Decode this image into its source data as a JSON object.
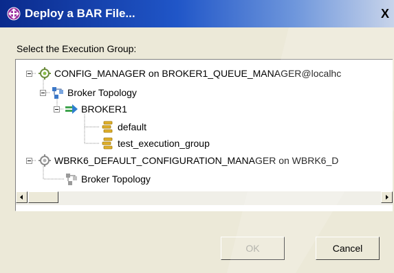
{
  "window": {
    "title": "Deploy a BAR File...",
    "close_label": "X"
  },
  "prompt": "Select the Execution Group:",
  "tree": {
    "nodes": [
      {
        "label": "CONFIG_MANAGER on BROKER1_QUEUE_MANAGER@localhc",
        "icon": "config-manager-icon",
        "expanded": true
      },
      {
        "label": "Broker Topology",
        "icon": "broker-topology-icon",
        "expanded": true
      },
      {
        "label": "BROKER1",
        "icon": "broker-icon",
        "expanded": true
      },
      {
        "label": "default",
        "icon": "execution-group-icon"
      },
      {
        "label": "test_execution_group",
        "icon": "execution-group-icon"
      },
      {
        "label": "WBRK6_DEFAULT_CONFIGURATION_MANAGER on WBRK6_D",
        "icon": "config-manager-icon",
        "expanded": true
      },
      {
        "label": "Broker Topology",
        "icon": "broker-topology-icon"
      }
    ]
  },
  "buttons": {
    "ok": "OK",
    "cancel": "Cancel"
  },
  "colors": {
    "title_bar": "#0a2a8c",
    "dialog_face": "#ece9d8",
    "disabled_text": "#a7a69e"
  }
}
